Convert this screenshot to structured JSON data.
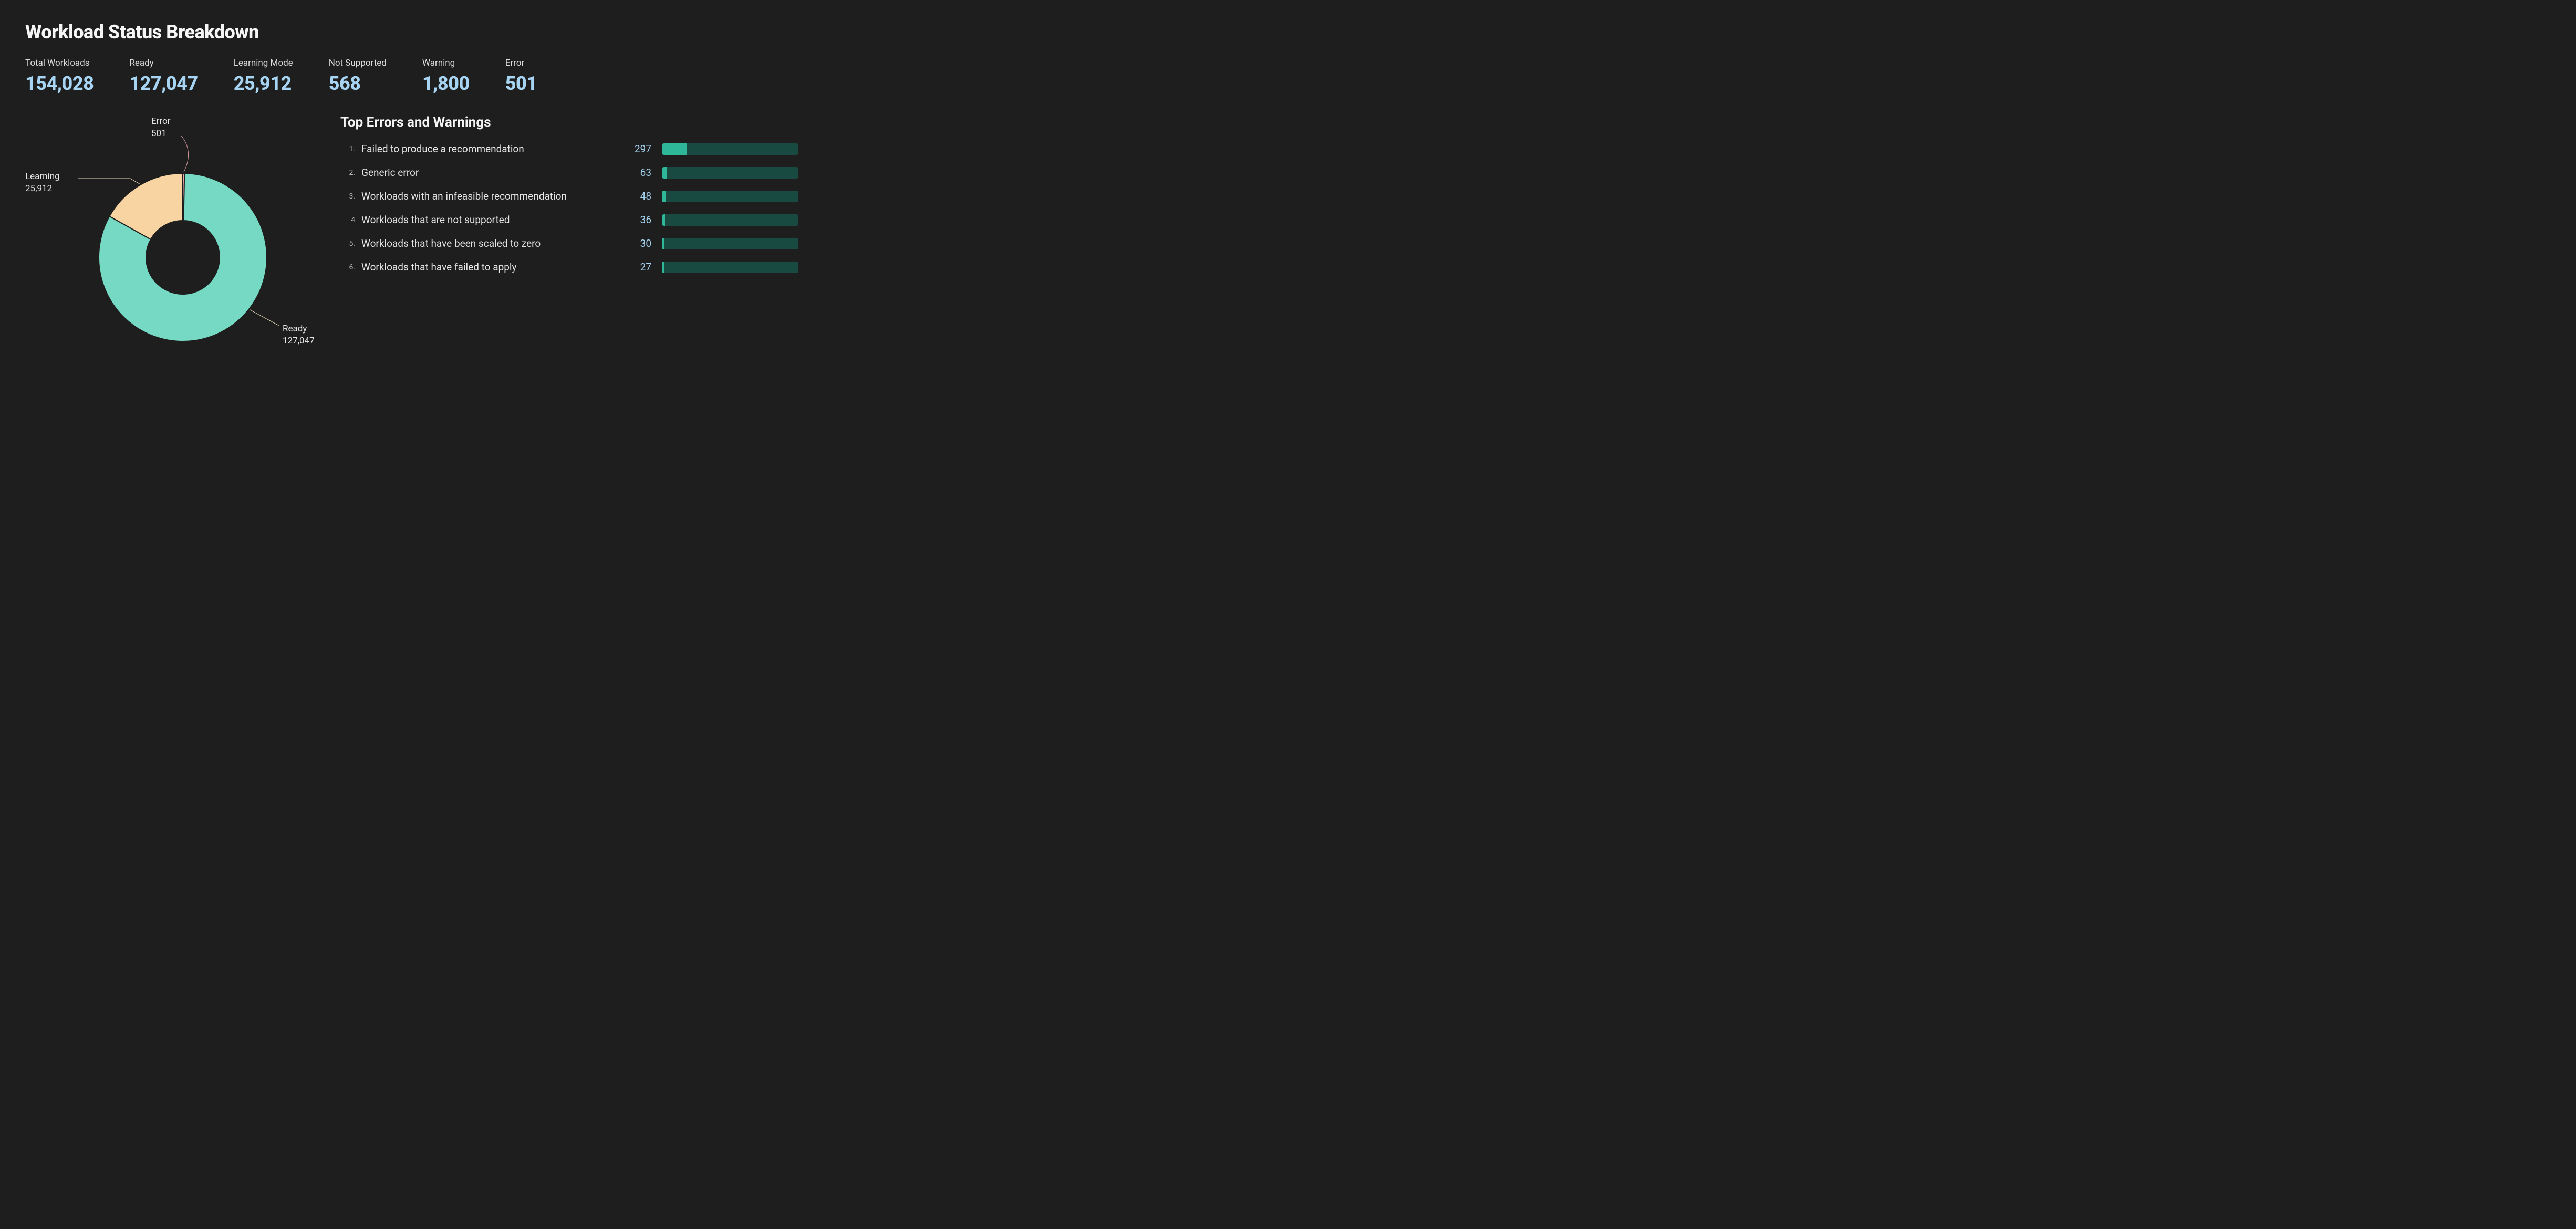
{
  "title": "Workload Status Breakdown",
  "stats": [
    {
      "label": "Total Workloads",
      "value": "154,028"
    },
    {
      "label": "Ready",
      "value": "127,047"
    },
    {
      "label": "Learning Mode",
      "value": "25,912"
    },
    {
      "label": "Not Supported",
      "value": "568"
    },
    {
      "label": "Warning",
      "value": "1,800"
    },
    {
      "label": "Error",
      "value": "501"
    }
  ],
  "donut": {
    "slices": [
      {
        "name": "Ready",
        "value": 127047,
        "label_line2": "127,047",
        "color": "#76d9c3"
      },
      {
        "name": "Learning",
        "value": 25912,
        "label_line2": "25,912",
        "color": "#f8d4a3"
      },
      {
        "name": "Error",
        "value": 501,
        "label_line2": "501",
        "color": "#f5a5a5"
      }
    ]
  },
  "errors_heading": "Top Errors and Warnings",
  "errors": [
    {
      "idx": "1.",
      "desc": "Failed to produce a recommendation",
      "count": 297
    },
    {
      "idx": "2.",
      "desc": "Generic error",
      "count": 63
    },
    {
      "idx": "3.",
      "desc": "Workloads with an infeasible recommendation",
      "count": 48
    },
    {
      "idx": "4",
      "desc": "Workloads that are not supported",
      "count": 36
    },
    {
      "idx": "5.",
      "desc": "Workloads that have been scaled to zero",
      "count": 30
    },
    {
      "idx": "6.",
      "desc": "Workloads that have failed to apply",
      "count": 27
    }
  ],
  "colors": {
    "accent_text": "#a6d4f2",
    "bar_track": "#184a42",
    "bar_fill": "#2fb79a",
    "leader_line": "#e8d8b8"
  },
  "chart_data": [
    {
      "type": "pie",
      "title": "Workload Status Breakdown",
      "series": [
        {
          "name": "Ready",
          "value": 127047
        },
        {
          "name": "Learning",
          "value": 25912
        },
        {
          "name": "Error",
          "value": 501
        }
      ]
    },
    {
      "type": "bar",
      "title": "Top Errors and Warnings",
      "categories": [
        "Failed to produce a recommendation",
        "Generic error",
        "Workloads with an infeasible recommendation",
        "Workloads that are not supported",
        "Workloads that have been scaled to zero",
        "Workloads that have failed to apply"
      ],
      "values": [
        297,
        63,
        48,
        36,
        30,
        27
      ],
      "xlabel": "",
      "ylabel": ""
    }
  ]
}
